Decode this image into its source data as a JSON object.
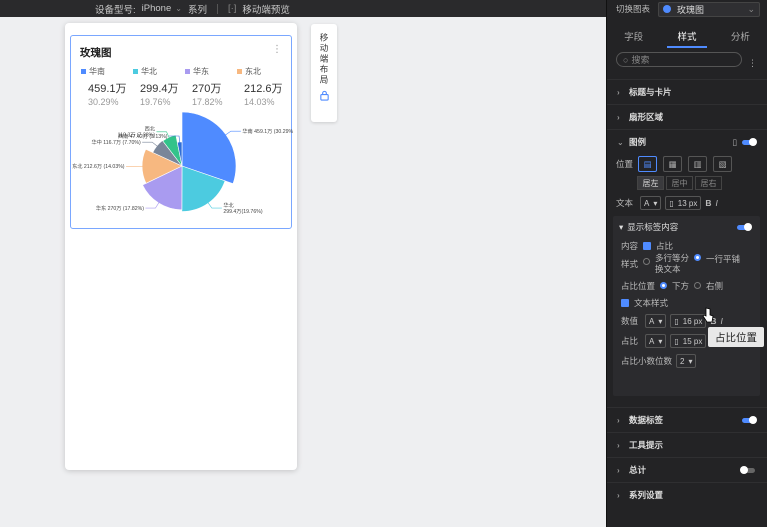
{
  "topbar": {
    "device_label": "设备型号:",
    "device_value": "iPhone",
    "series_label": "系列",
    "preview_label": "移动端预览"
  },
  "card": {
    "title": "玫瑰图",
    "legend": [
      {
        "name": "华南",
        "value": "459.1万",
        "pct": "30.29%",
        "color": "#4f8bff"
      },
      {
        "name": "华北",
        "value": "299.4万",
        "pct": "19.76%",
        "color": "#4ccbe0"
      },
      {
        "name": "华东",
        "value": "270万",
        "pct": "17.82%",
        "color": "#a99bf0"
      },
      {
        "name": "东北",
        "value": "212.6万",
        "pct": "14.03%",
        "color": "#f7b880"
      }
    ]
  },
  "chart_data": {
    "type": "pie",
    "subtype": "rose",
    "slices": [
      {
        "name": "华南",
        "value": 459.1,
        "pct": 30.29,
        "label": "华南 459.1万 (30.29%)",
        "color": "#4f8bff"
      },
      {
        "name": "华北",
        "value": 299.4,
        "pct": 19.76,
        "label": "华北\n299.4万(19.76%)",
        "color": "#4ccbe0"
      },
      {
        "name": "华东",
        "value": 270,
        "pct": 17.82,
        "label": "华东 270万 (17.82%)",
        "color": "#a99bf0"
      },
      {
        "name": "东北",
        "value": 212.6,
        "pct": 14.03,
        "label": "东北 212.6万 (14.03%)",
        "color": "#f7b880"
      },
      {
        "name": "华中",
        "value": 116.7,
        "pct": 7.7,
        "label": "华中 116.7万 (7.70%)",
        "color": "#7a8699"
      },
      {
        "name": "西北",
        "value": 110.3,
        "pct": 7.28,
        "label": "西北\n110.3万 (7.28%)",
        "color": "#33c38a"
      },
      {
        "name": "西南",
        "value": 47.42,
        "pct": 3.13,
        "label": "西南 47.42万 (3.13%)",
        "color": "#2f6fd8"
      }
    ]
  },
  "mobile_layout": {
    "label": "移动端布局"
  },
  "panel": {
    "switch_label": "切换图表",
    "chart_type": "玫瑰图",
    "tabs": [
      "字段",
      "样式",
      "分析"
    ],
    "active_tab": "样式",
    "search_placeholder": "搜索",
    "sections": {
      "title_card": "标题与卡片",
      "sector": "扇形区域",
      "legend": "图例",
      "data_label": "数据标签",
      "tooltip": "工具提示",
      "total": "总计",
      "series_settings": "系列设置"
    },
    "legend_opts": {
      "position_label": "位置",
      "align_options": [
        "居左",
        "居中",
        "居右"
      ],
      "selected_align": "居左",
      "text_label": "文本",
      "font_select": "A",
      "font_size": "13 px"
    },
    "show_label": {
      "title": "显示标签内容",
      "content_label": "内容",
      "content_value": "占比",
      "style_label": "样式",
      "style_opt1": "多行等分",
      "style_opt1b": "换文本",
      "style_opt2": "一行平铺",
      "pct_pos_label": "占比位置",
      "pos_below": "下方",
      "pos_right": "右侧",
      "text_style_label": "文本样式",
      "value_label": "数值",
      "value_size": "16 px",
      "pct_label": "占比",
      "pct_size": "15 px",
      "decimals_label": "占比小数位数",
      "decimals_value": "2"
    }
  },
  "tooltip_text": "占比位置"
}
